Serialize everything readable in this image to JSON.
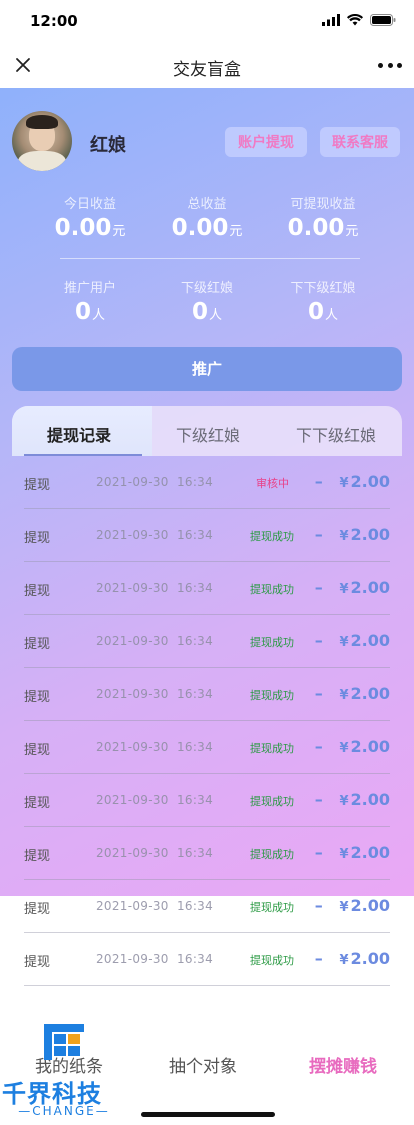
{
  "status_bar": {
    "time": "12:00"
  },
  "nav": {
    "title": "交友盲盒"
  },
  "profile": {
    "name": "红娘"
  },
  "actions": {
    "withdraw": "账户提现",
    "contact": "联系客服"
  },
  "earnings": {
    "today": {
      "label": "今日收益",
      "value": "0.00",
      "unit": "元"
    },
    "total": {
      "label": "总收益",
      "value": "0.00",
      "unit": "元"
    },
    "withdrawable": {
      "label": "可提现收益",
      "value": "0.00",
      "unit": "元"
    }
  },
  "team": {
    "referred": {
      "label": "推广用户",
      "value": "0",
      "unit": "人"
    },
    "sub": {
      "label": "下级红娘",
      "value": "0",
      "unit": "人"
    },
    "subsub": {
      "label": "下下级红娘",
      "value": "0",
      "unit": "人"
    }
  },
  "promote_label": "推广",
  "tabs": [
    "提现记录",
    "下级红娘",
    "下下级红娘"
  ],
  "records": [
    {
      "type": "提现",
      "time": "2021-09-30  16:34",
      "status": "审核中",
      "amount": "2.00",
      "sign": "–",
      "currency": "¥"
    },
    {
      "type": "提现",
      "time": "2021-09-30  16:34",
      "status": "提现成功",
      "amount": "2.00",
      "sign": "–",
      "currency": "¥"
    },
    {
      "type": "提现",
      "time": "2021-09-30  16:34",
      "status": "提现成功",
      "amount": "2.00",
      "sign": "–",
      "currency": "¥"
    },
    {
      "type": "提现",
      "time": "2021-09-30  16:34",
      "status": "提现成功",
      "amount": "2.00",
      "sign": "–",
      "currency": "¥"
    },
    {
      "type": "提现",
      "time": "2021-09-30  16:34",
      "status": "提现成功",
      "amount": "2.00",
      "sign": "–",
      "currency": "¥"
    },
    {
      "type": "提现",
      "time": "2021-09-30  16:34",
      "status": "提现成功",
      "amount": "2.00",
      "sign": "–",
      "currency": "¥"
    },
    {
      "type": "提现",
      "time": "2021-09-30  16:34",
      "status": "提现成功",
      "amount": "2.00",
      "sign": "–",
      "currency": "¥"
    },
    {
      "type": "提现",
      "time": "2021-09-30  16:34",
      "status": "提现成功",
      "amount": "2.00",
      "sign": "–",
      "currency": "¥"
    },
    {
      "type": "提现",
      "time": "2021-09-30  16:34",
      "status": "提现成功",
      "amount": "2.00",
      "sign": "–",
      "currency": "¥"
    },
    {
      "type": "提现",
      "time": "2021-09-30  16:34",
      "status": "提现成功",
      "amount": "2.00",
      "sign": "–",
      "currency": "¥"
    }
  ],
  "bottom_nav": [
    "我的纸条",
    "抽个对象",
    "摆摊赚钱"
  ],
  "watermark": {
    "title": "千界科技",
    "subtitle": "—CHANGE—"
  },
  "colors": {
    "accent_pink": "#e86bbf",
    "amount_blue": "#6c8be0",
    "pending": "#e8428a",
    "success": "#2b9a44"
  }
}
